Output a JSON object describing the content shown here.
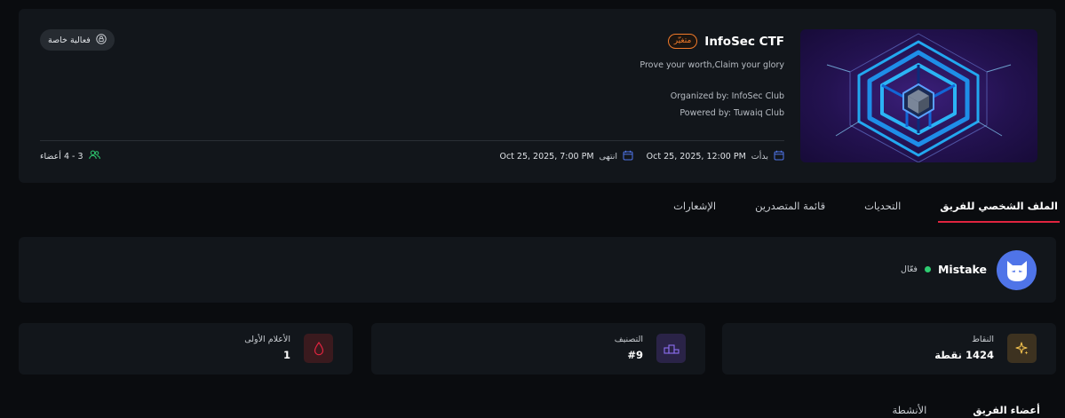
{
  "event": {
    "title": "InfoSec CTF",
    "badge": "متغيّر",
    "tagline": "Prove your worth,Claim your glory",
    "organized_by": "Organized by: InfoSec Club",
    "powered_by": "Powered by: Tuwaiq Club",
    "private_label": "فعالية خاصة",
    "start_label": "بدأت",
    "start_value": "Oct 25, 2025, 12:00 PM",
    "end_label": "انتهى",
    "end_value": "Oct 25, 2025, 7:00 PM",
    "members_label": "3 - 4 أعضاء"
  },
  "tabs": [
    {
      "label": "الملف الشخصي للفريق",
      "active": true
    },
    {
      "label": "التحديات",
      "active": false
    },
    {
      "label": "قائمة المتصدرين",
      "active": false
    },
    {
      "label": "الإشعارات",
      "active": false
    }
  ],
  "team": {
    "name": "Mistake",
    "status": "فعّال"
  },
  "stats": {
    "points": {
      "label": "النقاط",
      "value": "1424 نقطة"
    },
    "rank": {
      "label": "التصنيف",
      "value": "#9"
    },
    "first_bloods": {
      "label": "الأعلام الأولى",
      "value": "1"
    }
  },
  "subtabs": [
    {
      "label": "أعضاء الفريق",
      "active": true
    },
    {
      "label": "الأنشطة",
      "active": false
    }
  ],
  "colors": {
    "accent_red": "#e0243f",
    "avatar_blue": "#4f74e8",
    "badge_orange": "#f07a2a",
    "status_green": "#2ecc71"
  }
}
